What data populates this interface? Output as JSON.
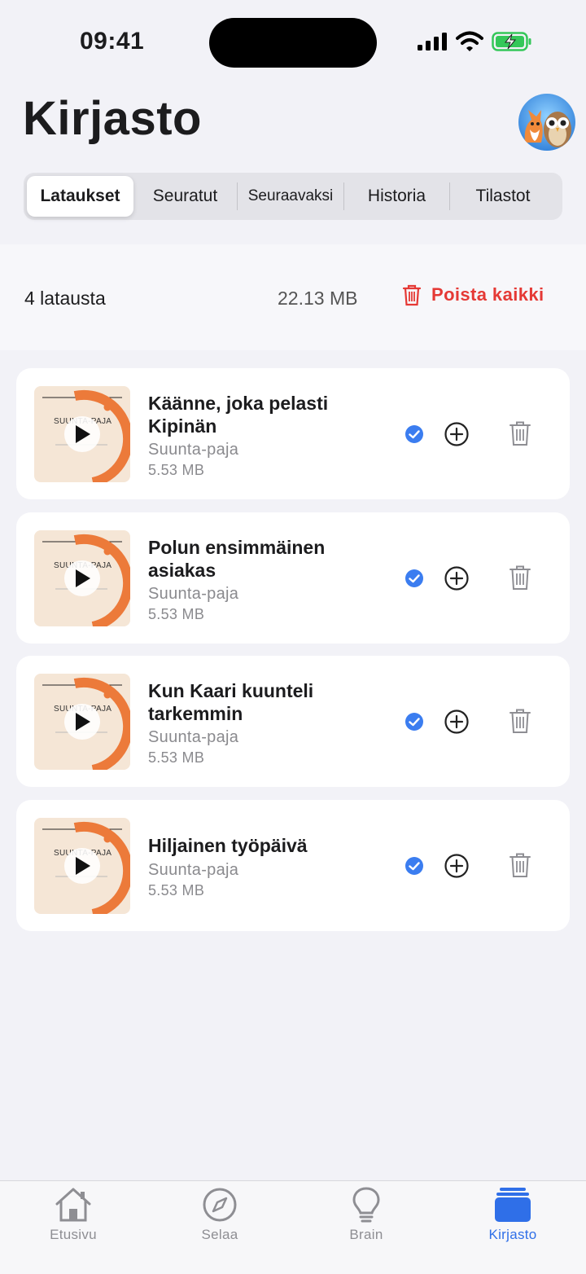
{
  "status_bar": {
    "time": "09:41"
  },
  "header": {
    "title": "Kirjasto"
  },
  "segments": [
    {
      "label": "Lataukset",
      "active": true
    },
    {
      "label": "Seuratut",
      "active": false
    },
    {
      "label": "Seuraavaksi",
      "active": false
    },
    {
      "label": "Historia",
      "active": false
    },
    {
      "label": "Tilastot",
      "active": false
    }
  ],
  "summary": {
    "count": "4 latausta",
    "total_size": "22.13 MB",
    "delete_all": "Poista kaikki"
  },
  "downloads": [
    {
      "title": "Käänne, joka pelasti Kipinän",
      "channel": "Suunta-paja",
      "size": "5.53 MB",
      "thumb_brand": "SUUNTA-PAJA",
      "downloaded": true
    },
    {
      "title": "Polun ensimmäinen asiakas",
      "channel": "Suunta-paja",
      "size": "5.53 MB",
      "thumb_brand": "SUUNTA-PAJA",
      "downloaded": true
    },
    {
      "title": "Kun Kaari kuunteli tarkemmin",
      "channel": "Suunta-paja",
      "size": "5.53 MB",
      "thumb_brand": "SUUNTA-PAJA",
      "downloaded": true
    },
    {
      "title": "Hiljainen työpäivä",
      "channel": "Suunta-paja",
      "size": "5.53 MB",
      "thumb_brand": "SUUNTA-PAJA",
      "downloaded": true
    }
  ],
  "tabbar": [
    {
      "label": "Etusivu",
      "icon": "house-icon",
      "active": false
    },
    {
      "label": "Selaa",
      "icon": "compass-icon",
      "active": false
    },
    {
      "label": "Brain",
      "icon": "lightbulb-icon",
      "active": false
    },
    {
      "label": "Kirjasto",
      "icon": "library-stack-icon",
      "active": true
    }
  ],
  "colors": {
    "accent": "#2f6fe8",
    "destructive": "#e53935",
    "check": "#3b7df0",
    "thumbnail_orange": "#ec7a3a",
    "background": "#f2f2f7"
  }
}
